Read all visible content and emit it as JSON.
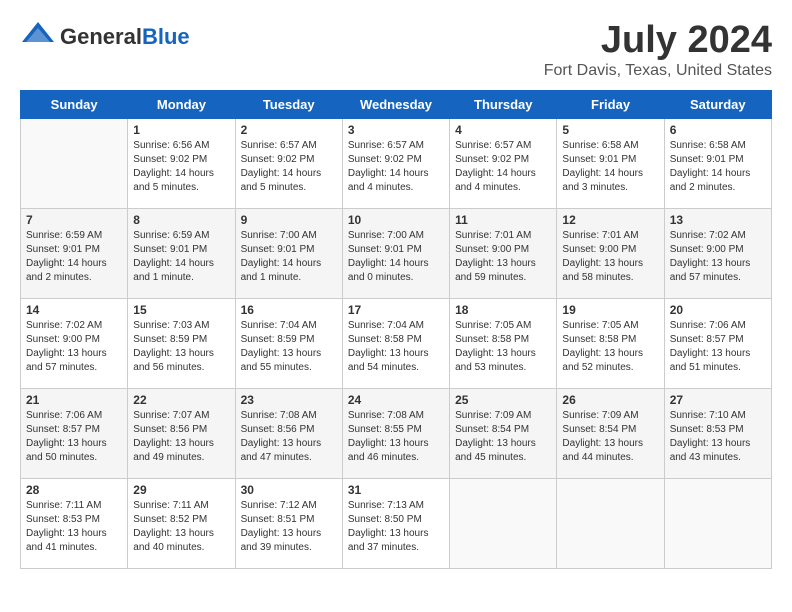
{
  "header": {
    "logo_general": "General",
    "logo_blue": "Blue",
    "month_year": "July 2024",
    "location": "Fort Davis, Texas, United States"
  },
  "days_of_week": [
    "Sunday",
    "Monday",
    "Tuesday",
    "Wednesday",
    "Thursday",
    "Friday",
    "Saturday"
  ],
  "weeks": [
    [
      {
        "day": "",
        "info": ""
      },
      {
        "day": "1",
        "info": "Sunrise: 6:56 AM\nSunset: 9:02 PM\nDaylight: 14 hours\nand 5 minutes."
      },
      {
        "day": "2",
        "info": "Sunrise: 6:57 AM\nSunset: 9:02 PM\nDaylight: 14 hours\nand 5 minutes."
      },
      {
        "day": "3",
        "info": "Sunrise: 6:57 AM\nSunset: 9:02 PM\nDaylight: 14 hours\nand 4 minutes."
      },
      {
        "day": "4",
        "info": "Sunrise: 6:57 AM\nSunset: 9:02 PM\nDaylight: 14 hours\nand 4 minutes."
      },
      {
        "day": "5",
        "info": "Sunrise: 6:58 AM\nSunset: 9:01 PM\nDaylight: 14 hours\nand 3 minutes."
      },
      {
        "day": "6",
        "info": "Sunrise: 6:58 AM\nSunset: 9:01 PM\nDaylight: 14 hours\nand 2 minutes."
      }
    ],
    [
      {
        "day": "7",
        "info": "Sunrise: 6:59 AM\nSunset: 9:01 PM\nDaylight: 14 hours\nand 2 minutes."
      },
      {
        "day": "8",
        "info": "Sunrise: 6:59 AM\nSunset: 9:01 PM\nDaylight: 14 hours\nand 1 minute."
      },
      {
        "day": "9",
        "info": "Sunrise: 7:00 AM\nSunset: 9:01 PM\nDaylight: 14 hours\nand 1 minute."
      },
      {
        "day": "10",
        "info": "Sunrise: 7:00 AM\nSunset: 9:01 PM\nDaylight: 14 hours\nand 0 minutes."
      },
      {
        "day": "11",
        "info": "Sunrise: 7:01 AM\nSunset: 9:00 PM\nDaylight: 13 hours\nand 59 minutes."
      },
      {
        "day": "12",
        "info": "Sunrise: 7:01 AM\nSunset: 9:00 PM\nDaylight: 13 hours\nand 58 minutes."
      },
      {
        "day": "13",
        "info": "Sunrise: 7:02 AM\nSunset: 9:00 PM\nDaylight: 13 hours\nand 57 minutes."
      }
    ],
    [
      {
        "day": "14",
        "info": "Sunrise: 7:02 AM\nSunset: 9:00 PM\nDaylight: 13 hours\nand 57 minutes."
      },
      {
        "day": "15",
        "info": "Sunrise: 7:03 AM\nSunset: 8:59 PM\nDaylight: 13 hours\nand 56 minutes."
      },
      {
        "day": "16",
        "info": "Sunrise: 7:04 AM\nSunset: 8:59 PM\nDaylight: 13 hours\nand 55 minutes."
      },
      {
        "day": "17",
        "info": "Sunrise: 7:04 AM\nSunset: 8:58 PM\nDaylight: 13 hours\nand 54 minutes."
      },
      {
        "day": "18",
        "info": "Sunrise: 7:05 AM\nSunset: 8:58 PM\nDaylight: 13 hours\nand 53 minutes."
      },
      {
        "day": "19",
        "info": "Sunrise: 7:05 AM\nSunset: 8:58 PM\nDaylight: 13 hours\nand 52 minutes."
      },
      {
        "day": "20",
        "info": "Sunrise: 7:06 AM\nSunset: 8:57 PM\nDaylight: 13 hours\nand 51 minutes."
      }
    ],
    [
      {
        "day": "21",
        "info": "Sunrise: 7:06 AM\nSunset: 8:57 PM\nDaylight: 13 hours\nand 50 minutes."
      },
      {
        "day": "22",
        "info": "Sunrise: 7:07 AM\nSunset: 8:56 PM\nDaylight: 13 hours\nand 49 minutes."
      },
      {
        "day": "23",
        "info": "Sunrise: 7:08 AM\nSunset: 8:56 PM\nDaylight: 13 hours\nand 47 minutes."
      },
      {
        "day": "24",
        "info": "Sunrise: 7:08 AM\nSunset: 8:55 PM\nDaylight: 13 hours\nand 46 minutes."
      },
      {
        "day": "25",
        "info": "Sunrise: 7:09 AM\nSunset: 8:54 PM\nDaylight: 13 hours\nand 45 minutes."
      },
      {
        "day": "26",
        "info": "Sunrise: 7:09 AM\nSunset: 8:54 PM\nDaylight: 13 hours\nand 44 minutes."
      },
      {
        "day": "27",
        "info": "Sunrise: 7:10 AM\nSunset: 8:53 PM\nDaylight: 13 hours\nand 43 minutes."
      }
    ],
    [
      {
        "day": "28",
        "info": "Sunrise: 7:11 AM\nSunset: 8:53 PM\nDaylight: 13 hours\nand 41 minutes."
      },
      {
        "day": "29",
        "info": "Sunrise: 7:11 AM\nSunset: 8:52 PM\nDaylight: 13 hours\nand 40 minutes."
      },
      {
        "day": "30",
        "info": "Sunrise: 7:12 AM\nSunset: 8:51 PM\nDaylight: 13 hours\nand 39 minutes."
      },
      {
        "day": "31",
        "info": "Sunrise: 7:13 AM\nSunset: 8:50 PM\nDaylight: 13 hours\nand 37 minutes."
      },
      {
        "day": "",
        "info": ""
      },
      {
        "day": "",
        "info": ""
      },
      {
        "day": "",
        "info": ""
      }
    ]
  ]
}
